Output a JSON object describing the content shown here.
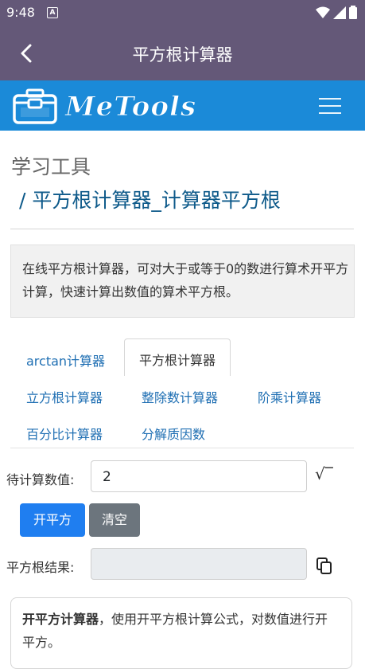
{
  "status": {
    "time": "9:48",
    "notif_icon": "A"
  },
  "appbar": {
    "title": "平方根计算器"
  },
  "navbar": {
    "brand": "MeTools"
  },
  "breadcrumb": {
    "section": "学习工具",
    "page": "/ 平方根计算器_计算器平方根"
  },
  "description": "在线平方根计算器，可对大于或等于0的数进行算术开平方计算，快速计算出数值的算术平方根。",
  "tabs": [
    {
      "label": "arctan计算器",
      "active": false
    },
    {
      "label": "平方根计算器",
      "active": true
    },
    {
      "label": "立方根计算器",
      "active": false
    },
    {
      "label": "整除数计算器",
      "active": false
    },
    {
      "label": "阶乘计算器",
      "active": false
    },
    {
      "label": "百分比计算器",
      "active": false
    },
    {
      "label": "分解质因数",
      "active": false
    }
  ],
  "form": {
    "input_label": "待计算数值:",
    "input_value": "2",
    "sqrt_symbol": "√‾",
    "calc_button": "开平方",
    "clear_button": "清空",
    "result_label": "平方根结果:",
    "result_value": ""
  },
  "card": {
    "title": "开平方计算器",
    "text": "，使用开平方根计算公式，对数值进行开平方。"
  },
  "colors": {
    "appbar": "#645878",
    "navbar": "#1b8ad8",
    "primary": "#1f7ef0",
    "secondary": "#6c757d"
  }
}
